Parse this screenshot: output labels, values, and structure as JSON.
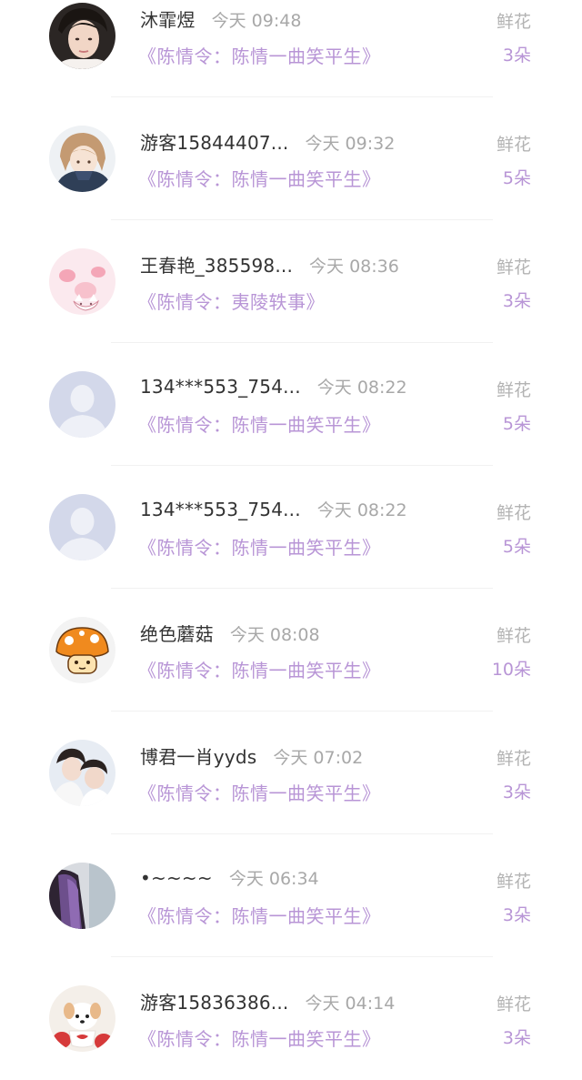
{
  "gift_records": [
    {
      "name": "沐霏煜",
      "time": "今天 09:48",
      "book": "《陈情令：陈情一曲笑平生》",
      "gift_label": "鲜花",
      "gift_count": "3朵",
      "avatar": "photo-young-man-avatar"
    },
    {
      "name": "游客15844407...",
      "time": "今天 09:32",
      "book": "《陈情令：陈情一曲笑平生》",
      "gift_label": "鲜花",
      "gift_count": "5朵",
      "avatar": "illustrated-girl-avatar"
    },
    {
      "name": "王春艳_385598...",
      "time": "今天 08:36",
      "book": "《陈情令：夷陵轶事》",
      "gift_label": "鲜花",
      "gift_count": "3朵",
      "avatar": "pink-cat-avatar"
    },
    {
      "name": "134***553_754...",
      "time": "今天 08:22",
      "book": "《陈情令：陈情一曲笑平生》",
      "gift_label": "鲜花",
      "gift_count": "5朵",
      "avatar": "default-user-avatar"
    },
    {
      "name": "134***553_754...",
      "time": "今天 08:22",
      "book": "《陈情令：陈情一曲笑平生》",
      "gift_label": "鲜花",
      "gift_count": "5朵",
      "avatar": "default-user-avatar"
    },
    {
      "name": "绝色蘑菇",
      "time": "今天 08:08",
      "book": "《陈情令：陈情一曲笑平生》",
      "gift_label": "鲜花",
      "gift_count": "10朵",
      "avatar": "mushroom-avatar"
    },
    {
      "name": "博君一肖yyds",
      "time": "今天 07:02",
      "book": "《陈情令：陈情一曲笑平生》",
      "gift_label": "鲜花",
      "gift_count": "3朵",
      "avatar": "two-men-photo-avatar"
    },
    {
      "name": "•~~~~",
      "time": "今天 06:34",
      "book": "《陈情令：陈情一曲笑平生》",
      "gift_label": "鲜花",
      "gift_count": "3朵",
      "avatar": "purple-hair-avatar"
    },
    {
      "name": "游客15836386...",
      "time": "今天 04:14",
      "book": "《陈情令：陈情一曲笑平生》",
      "gift_label": "鲜花",
      "gift_count": "3朵",
      "avatar": "puppy-avatar"
    }
  ],
  "colors": {
    "accent_purple": "#b895d6",
    "name_text": "#333333",
    "secondary_text": "#a8a8a8",
    "default_avatar_bg": "#d3d8ea"
  }
}
